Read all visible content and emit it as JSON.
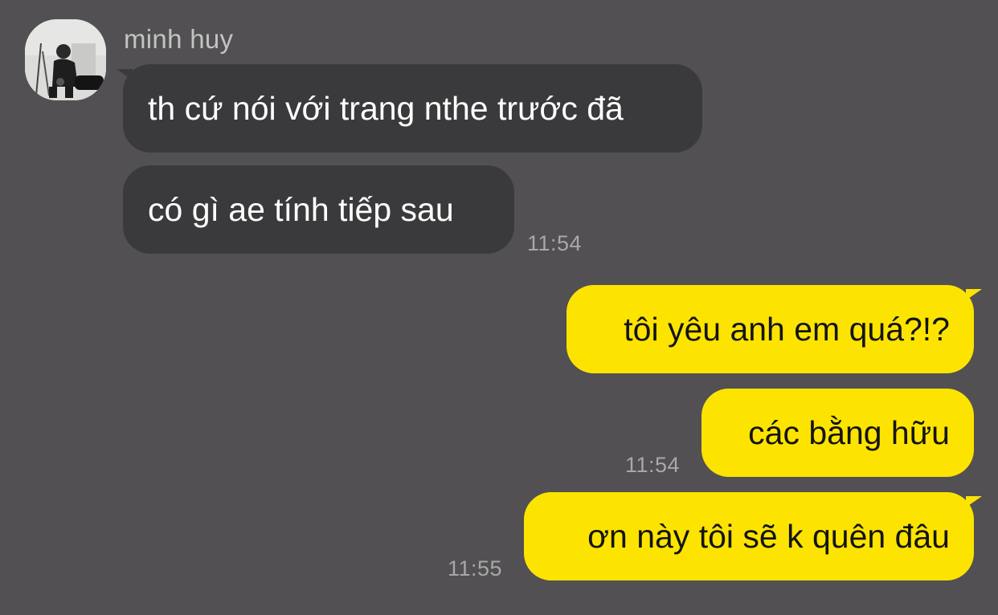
{
  "chat": {
    "contact": {
      "name": "minh huy",
      "avatar_icon": "profile-photo"
    },
    "messages": [
      {
        "direction": "incoming",
        "text": "th cứ nói với trang nthe trước đã",
        "time": ""
      },
      {
        "direction": "incoming",
        "text": "có gì ae tính tiếp sau",
        "time": "11:54"
      },
      {
        "direction": "outgoing",
        "text": "tôi yêu anh em quá?!?",
        "time": ""
      },
      {
        "direction": "outgoing",
        "text": "các bằng hữu",
        "time": "11:54"
      },
      {
        "direction": "outgoing",
        "text": "ơn này tôi sẽ k quên đâu",
        "time": "11:55"
      }
    ]
  },
  "colors": {
    "background": "#525052",
    "incoming_bubble": "#3a3a3c",
    "outgoing_bubble": "#fde400",
    "timestamp": "#a8a8a8"
  }
}
